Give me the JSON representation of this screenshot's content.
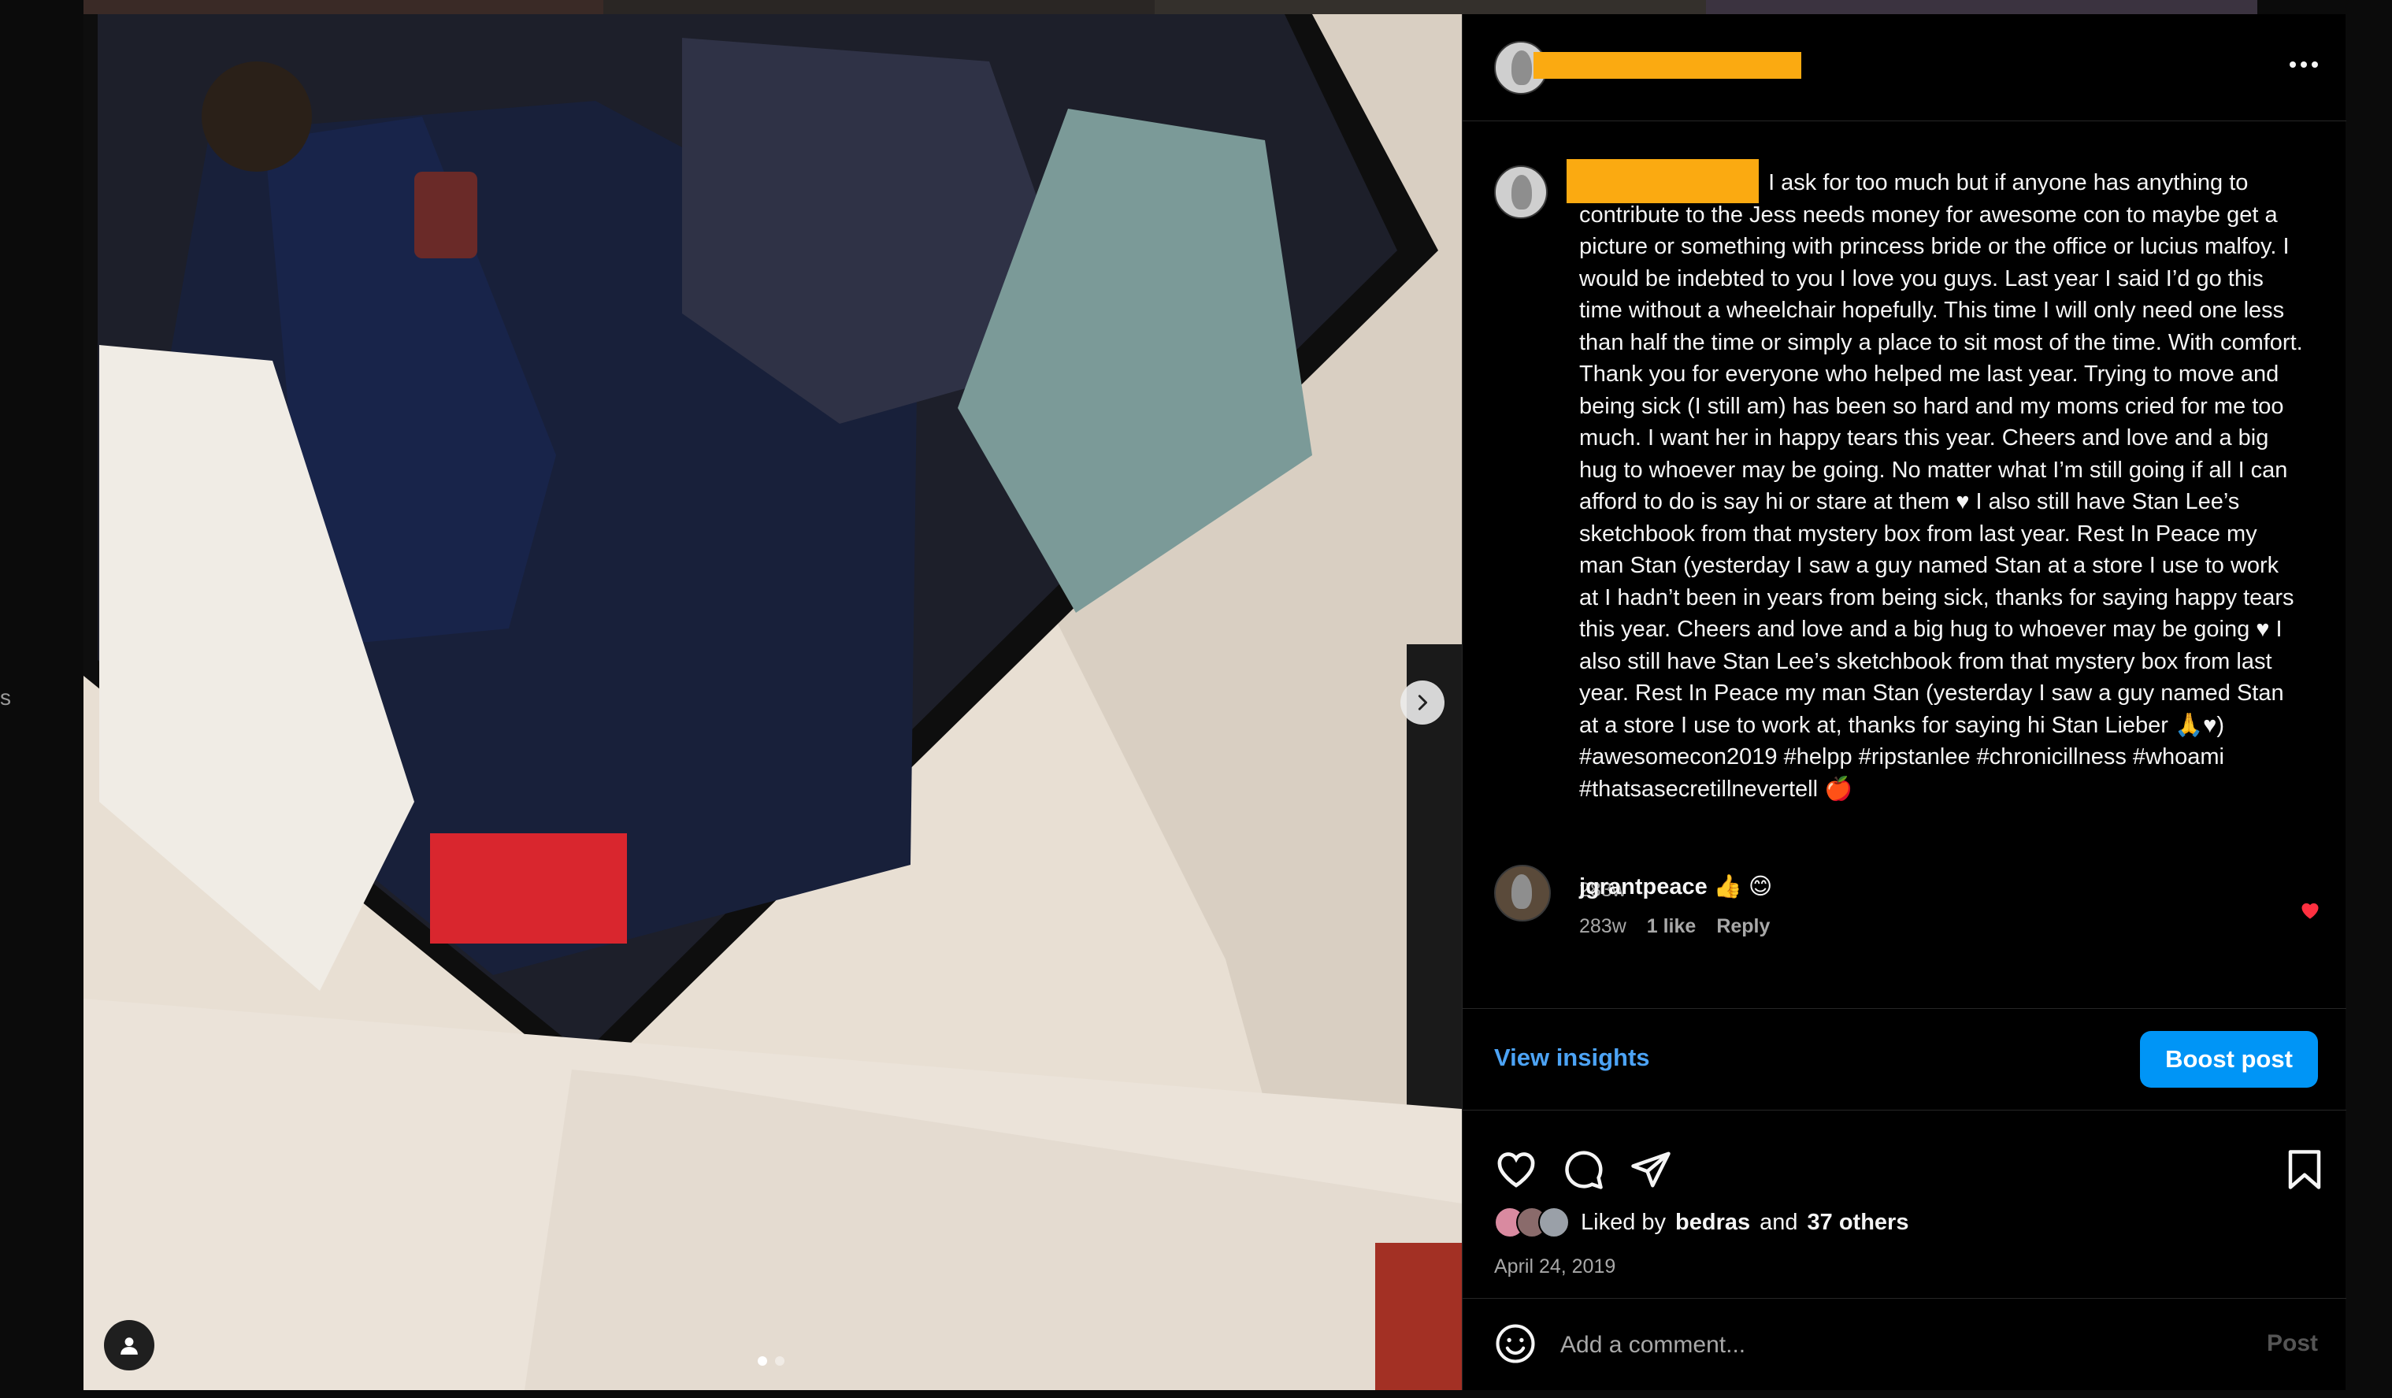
{
  "backdrop": {
    "side_text": "s"
  },
  "post": {
    "username_redacted": true,
    "caption": " I ask for too much but if anyone has anything to contribute to the Jess needs money for awesome con to maybe get a picture or something with princess bride or the office or lucius malfoy. I would be indebted to you I love you guys. Last year I said I’d go this time without a wheelchair hopefully. This time I will only need one less than half the time or simply a place to sit most of the time. With comfort. Thank you for everyone who helped me last year. Trying to move and being sick (I still am) has been so hard and my moms cried for me too much. I want her in happy tears this year. Cheers and love and a big hug to whoever may be going. No matter what I’m still going if all I can afford to do is say hi or stare at them ♥ I also still have Stan Lee’s sketchbook from that mystery box from last year. Rest In Peace my man Stan (yesterday I saw a guy named Stan at a store I use to work at I hadn’t been in years from being sick, thanks for saying happy tears this year. Cheers and love and a big hug to whoever may be going ♥ I also still have Stan Lee’s sketchbook from that mystery box from last year. Rest In Peace my man Stan (yesterday I saw a guy named Stan at a store I use to work at, thanks for saying hi Stan Lieber 🙏♥)\n#awesomecon2019 #helpp #ripstanlee #chronicillness #whoami #thatsasecretillnevertell 🍎",
    "caption_time": "283w",
    "carousel": {
      "total": 2,
      "active": 1
    }
  },
  "comment": {
    "username": "jgrantpeace",
    "text": "👍 😊",
    "time": "283w",
    "likes": "1 like",
    "reply": "Reply"
  },
  "insights": {
    "view_label": "View insights",
    "boost_label": "Boost post"
  },
  "likes": {
    "prefix": "Liked by",
    "user": "bedras",
    "middle": "and",
    "others": "37 others"
  },
  "date": "April 24, 2019",
  "comment_box": {
    "placeholder": "Add a comment...",
    "post_label": "Post"
  },
  "colors": {
    "accent": "#0095f6",
    "link": "#4ca3f5",
    "heart": "#ff3040",
    "redaction": "#fbaa11"
  }
}
